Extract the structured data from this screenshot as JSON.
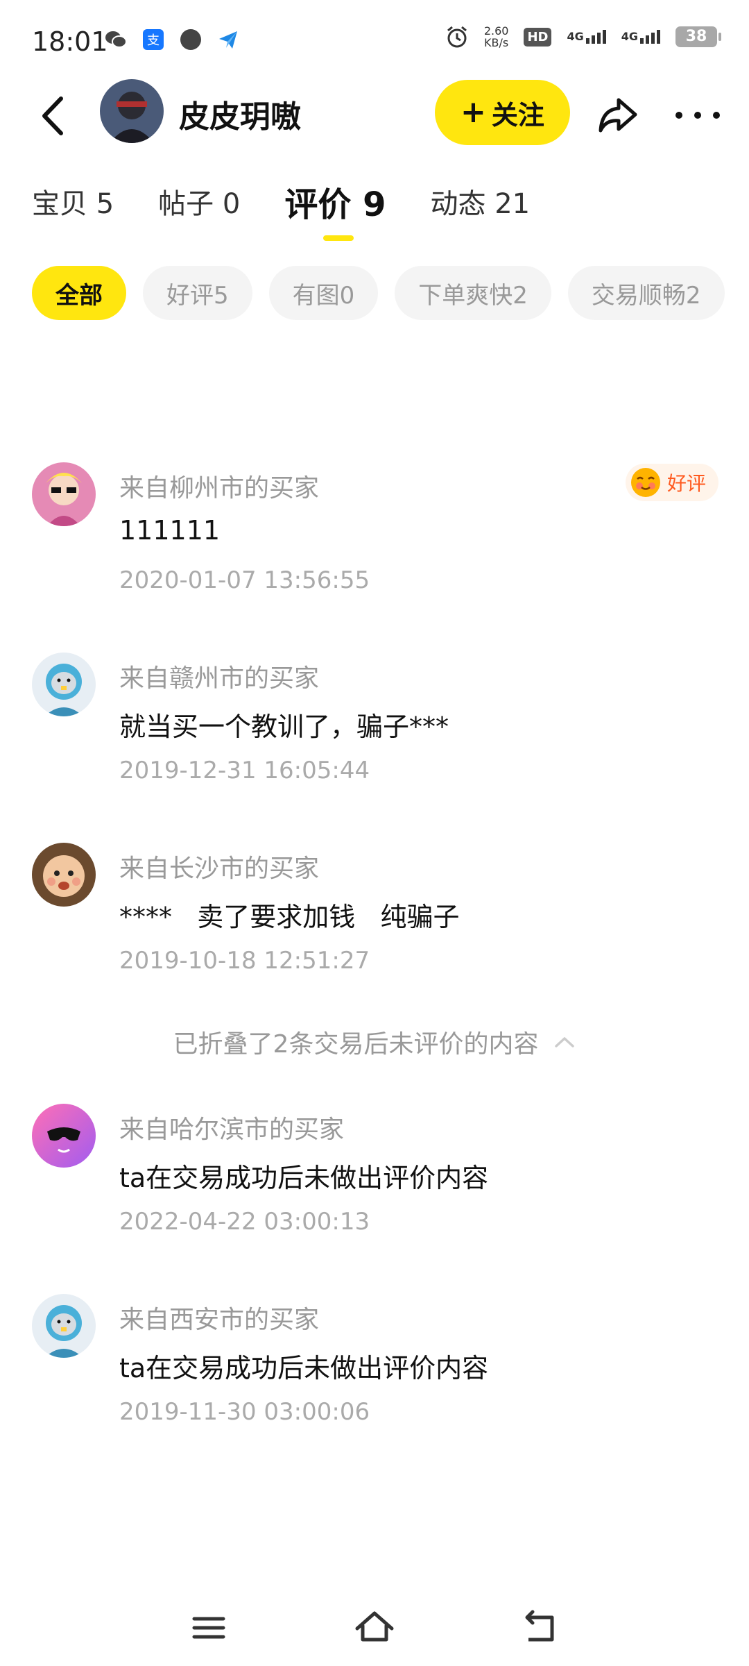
{
  "status_bar": {
    "time": "18:01",
    "left_icons": [
      "wechat-icon",
      "alipay-icon",
      "compass-icon",
      "paper-plane-icon"
    ],
    "net_speed_value": "2.60",
    "net_speed_unit": "KB/s",
    "hd_label": "HD",
    "network_1": "4G",
    "network_2": "4G",
    "battery": "38"
  },
  "header": {
    "username": "皮皮玥嗷",
    "follow_plus": "+",
    "follow_label": "关注"
  },
  "tabs": [
    {
      "label": "宝贝",
      "count": "5"
    },
    {
      "label": "帖子",
      "count": "0"
    },
    {
      "label": "评价",
      "count": "9"
    },
    {
      "label": "动态",
      "count": "21"
    }
  ],
  "chips": [
    "全部",
    "好评5",
    "有图0",
    "下单爽快2",
    "交易顺畅2"
  ],
  "reviews": [
    {
      "from": "来自柳州市的买家",
      "content": "111111",
      "time": "2020-01-07 13:56:55",
      "badge": "好评"
    },
    {
      "from": "来自赣州市的买家",
      "content": "就当买一个教训了，骗子***",
      "time": "2019-12-31 16:05:44"
    },
    {
      "from": "来自长沙市的买家",
      "content": "****   卖了要求加钱   纯骗子",
      "time": "2019-10-18 12:51:27"
    },
    {
      "from": "来自哈尔滨市的买家",
      "content": "ta在交易成功后未做出评价内容",
      "time": "2022-04-22 03:00:13"
    },
    {
      "from": "来自西安市的买家",
      "content": "ta在交易成功后未做出评价内容",
      "time": "2019-11-30 03:00:06"
    }
  ],
  "fold_note": "已折叠了2条交易后未评价的内容",
  "colors": {
    "accent_yellow": "#ffe60f",
    "badge_orange": "#ff5a1f",
    "muted_text": "#999999"
  }
}
